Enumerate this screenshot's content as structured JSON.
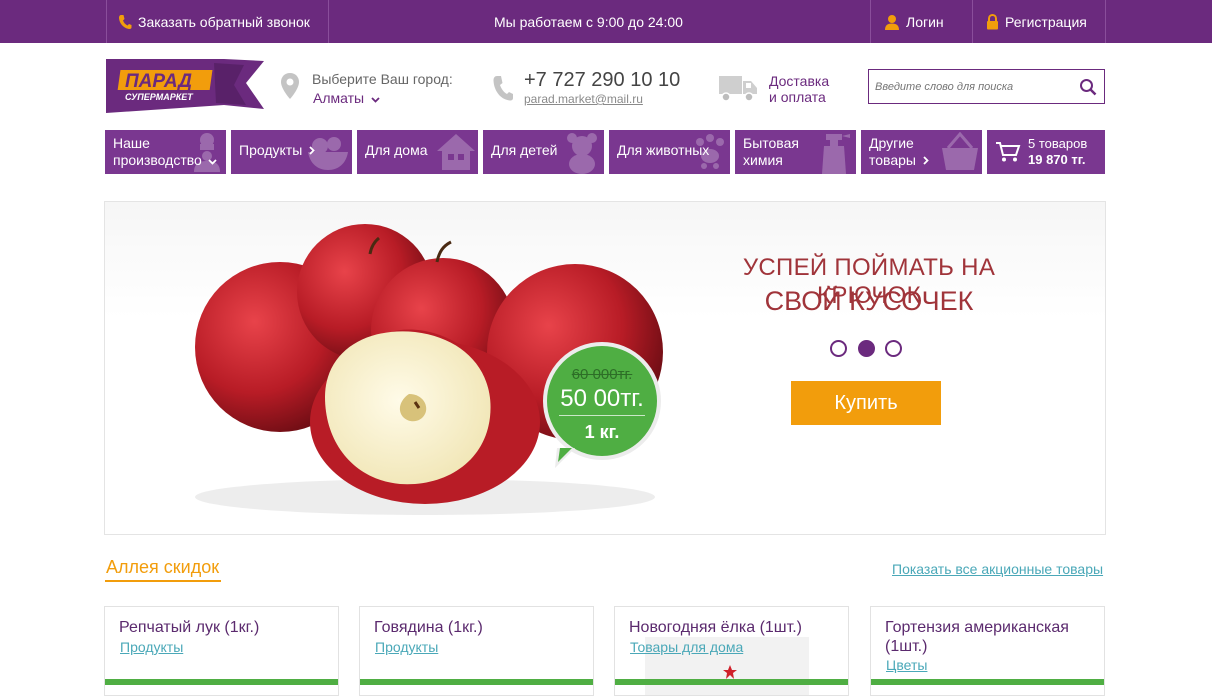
{
  "topbar": {
    "callback": "Заказать обратный звонок",
    "hours": "Мы работаем с 9:00 до 24:00",
    "login": "Логин",
    "register": "Регистрация"
  },
  "logo": {
    "line1": "ПАРАД",
    "line2": "СУПЕРМАРКЕТ"
  },
  "city": {
    "label": "Выберите Ваш город:",
    "value": "Алматы"
  },
  "contact": {
    "phone": "+7 727 290 10 10",
    "email": "parad.market@mail.ru"
  },
  "delivery": {
    "line1": "Доставка",
    "line2": "и оплата"
  },
  "search": {
    "placeholder": "Введите слово для поиска"
  },
  "nav": [
    {
      "line1": "Наше",
      "line2": "производство"
    },
    {
      "label": "Продукты"
    },
    {
      "label": "Для дома"
    },
    {
      "label": "Для детей"
    },
    {
      "label": "Для животных"
    },
    {
      "line1": "Бытовая",
      "line2": "химия"
    },
    {
      "line1": "Другие",
      "line2": "товары"
    }
  ],
  "cart": {
    "count": "5 товаров",
    "total": "19 870 тг."
  },
  "banner": {
    "line1": "УСПЕЙ ПОЙМАТЬ НА КРЮЧОК",
    "line2": "СВОЙ КУСОЧЕК",
    "old_price": "60 000тг.",
    "new_price": "50 00тг.",
    "unit": "1 кг.",
    "buy": "Купить",
    "active_slide": 2
  },
  "discounts": {
    "title": "Аллея скидок",
    "show_all": "Показать все акционные товары",
    "items": [
      {
        "title": "Репчатый лук (1кг.)",
        "category": "Продукты"
      },
      {
        "title": "Говядина (1кг.)",
        "category": "Продукты"
      },
      {
        "title": "Новогодняя ёлка (1шт.)",
        "category": "Товары для дома"
      },
      {
        "title": "Гортензия американская (1шт.)",
        "category": "Цветы"
      }
    ]
  },
  "colors": {
    "brand": "#6b2a7e",
    "nav": "#7a3790",
    "accent": "#f29d0c",
    "price": "#4fae43",
    "link": "#4aa8b8",
    "promo": "#a0343a"
  }
}
